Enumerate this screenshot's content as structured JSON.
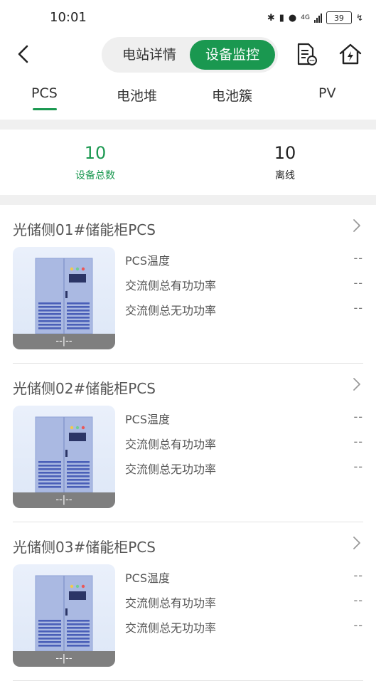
{
  "status_bar": {
    "time": "10:01",
    "battery": "39",
    "network": "4G"
  },
  "header": {
    "segments": [
      "电站详情",
      "设备监控"
    ],
    "active_segment": 1
  },
  "tabs": [
    "PCS",
    "电池堆",
    "电池簇",
    "PV"
  ],
  "summary": {
    "total_value": "10",
    "total_label": "设备总数",
    "offline_value": "10",
    "offline_label": "离线"
  },
  "devices": [
    {
      "name": "光储侧01#储能柜PCS",
      "status": "--|--",
      "metrics": [
        {
          "label": "PCS温度",
          "value": "--"
        },
        {
          "label": "交流侧总有功功率",
          "value": "--"
        },
        {
          "label": "交流侧总无功功率",
          "value": "--"
        }
      ]
    },
    {
      "name": "光储侧02#储能柜PCS",
      "status": "--|--",
      "metrics": [
        {
          "label": "PCS温度",
          "value": "--"
        },
        {
          "label": "交流侧总有功功率",
          "value": "--"
        },
        {
          "label": "交流侧总无功功率",
          "value": "--"
        }
      ]
    },
    {
      "name": "光储侧03#储能柜PCS",
      "status": "--|--",
      "metrics": [
        {
          "label": "PCS温度",
          "value": "--"
        },
        {
          "label": "交流侧总有功功率",
          "value": "--"
        },
        {
          "label": "交流侧总无功功率",
          "value": "--"
        }
      ]
    }
  ],
  "colors": {
    "accent": "#1a9850",
    "text": "#222222",
    "muted": "#555555"
  }
}
